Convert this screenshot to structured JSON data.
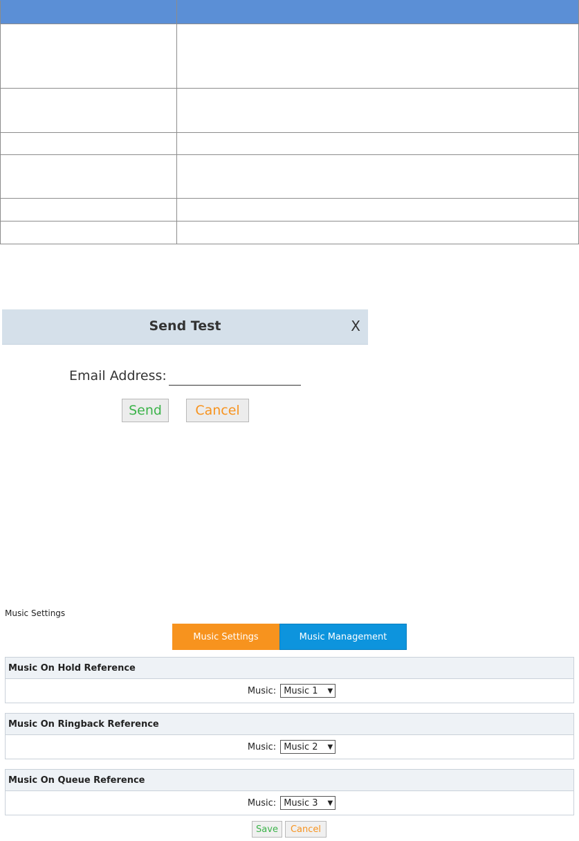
{
  "dialog": {
    "title": "Send Test",
    "close": "X",
    "email_label": "Email Address:",
    "email_value": "",
    "send_label": "Send",
    "cancel_label": "Cancel"
  },
  "music": {
    "page_label": "Music Settings",
    "tabs": [
      {
        "label": "Music Settings",
        "active": true
      },
      {
        "label": "Music Management",
        "active": false
      }
    ],
    "sections": [
      {
        "title": "Music On Hold Reference",
        "field_label": "Music:",
        "value": "Music 1"
      },
      {
        "title": "Music On Ringback Reference",
        "field_label": "Music:",
        "value": "Music 2"
      },
      {
        "title": "Music On Queue Reference",
        "field_label": "Music:",
        "value": "Music 3"
      }
    ],
    "save_label": "Save",
    "cancel_label": "Cancel"
  },
  "colors": {
    "table_header": "#5b8fd6",
    "tab_active": "#f7931e",
    "tab_inactive": "#0d94dd",
    "send_green": "#3cb34a",
    "cancel_orange": "#f7931e"
  }
}
